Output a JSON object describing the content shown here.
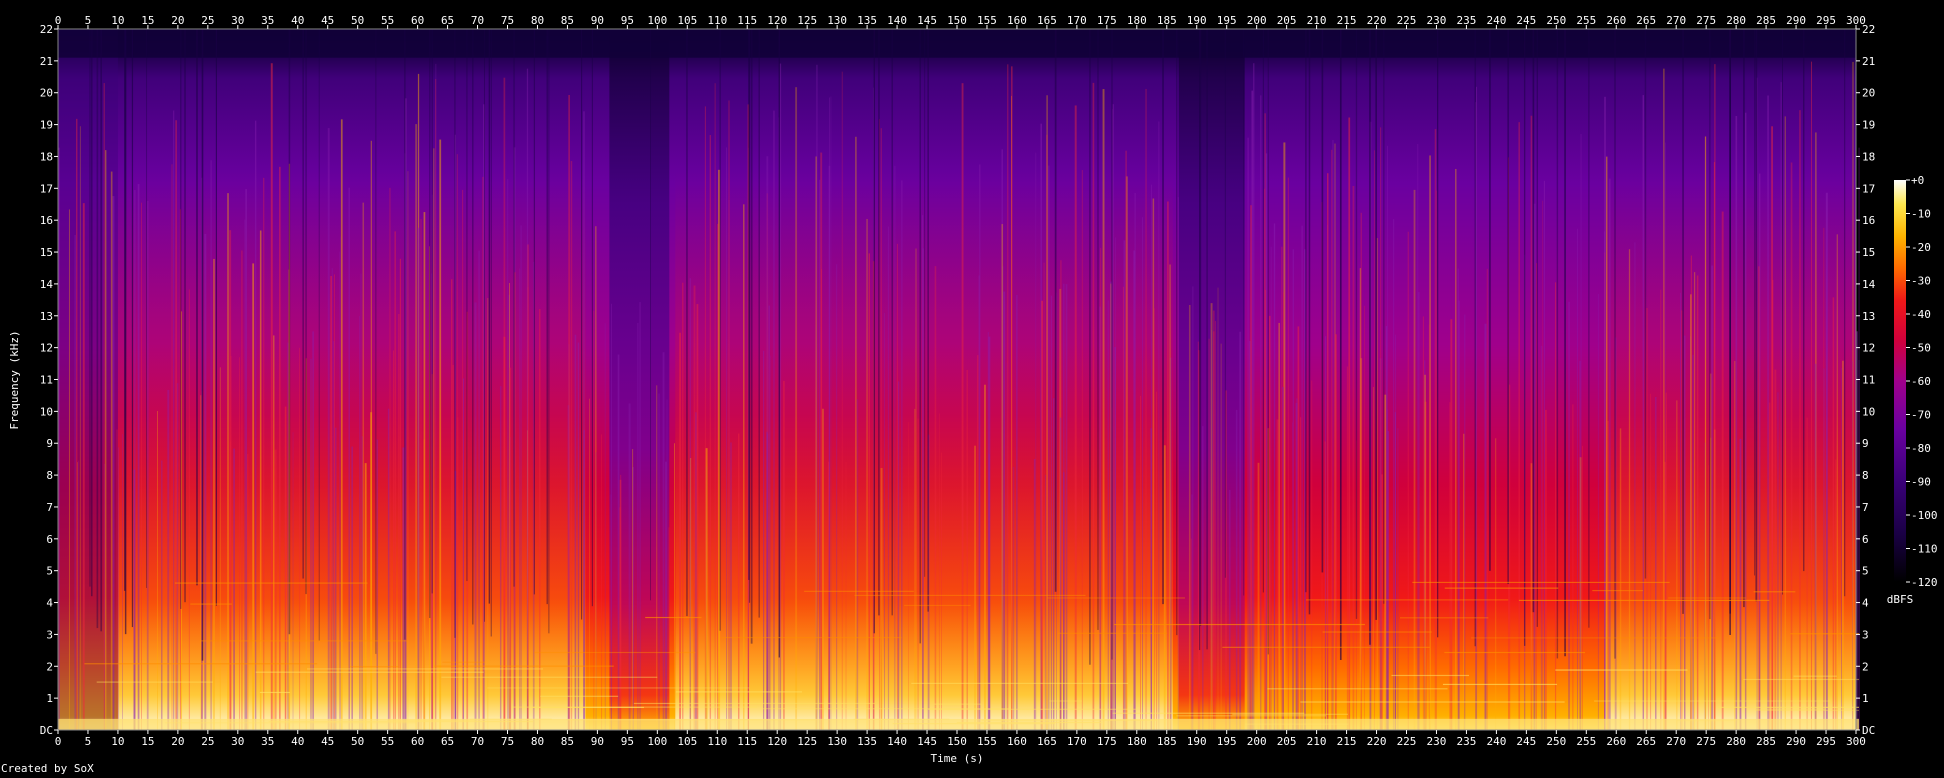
{
  "chart_data": {
    "type": "heatmap",
    "subtype": "spectrogram",
    "xlabel": "Time (s)",
    "ylabel": "Frequency (kHz)",
    "xlim": [
      0,
      300
    ],
    "ylim": [
      0,
      22
    ],
    "x_ticks": [
      "0",
      "5",
      "10",
      "15",
      "20",
      "25",
      "30",
      "35",
      "40",
      "45",
      "50",
      "55",
      "60",
      "65",
      "70",
      "75",
      "80",
      "85",
      "90",
      "95",
      "100",
      "105",
      "110",
      "115",
      "120",
      "125",
      "130",
      "135",
      "140",
      "145",
      "150",
      "155",
      "160",
      "165",
      "170",
      "175",
      "180",
      "185",
      "190",
      "195",
      "200",
      "205",
      "210",
      "215",
      "220",
      "225",
      "230",
      "235",
      "240",
      "245",
      "250",
      "255",
      "260",
      "265",
      "270",
      "275",
      "280",
      "285",
      "290",
      "295",
      "300"
    ],
    "y_ticks": [
      "DC",
      "1",
      "2",
      "3",
      "4",
      "5",
      "6",
      "7",
      "8",
      "9",
      "10",
      "11",
      "12",
      "13",
      "14",
      "15",
      "16",
      "17",
      "18",
      "19",
      "20",
      "21",
      "22"
    ],
    "colorbar": {
      "label": "dBFS",
      "range": [
        -120,
        0
      ],
      "ticks": [
        "+0",
        "-10",
        "-20",
        "-30",
        "-40",
        "-50",
        "-60",
        "-70",
        "-80",
        "-90",
        "-100",
        "-110",
        "-120"
      ]
    },
    "colormap": [
      "#000000",
      "#1a0045",
      "#3a0078",
      "#6a00a0",
      "#a0008c",
      "#d0003c",
      "#f01818",
      "#ff6a00",
      "#ffb400",
      "#ffe850",
      "#ffffff"
    ],
    "audio_end_s": 300.5,
    "quiet_sections_s": [
      [
        92,
        102
      ],
      [
        187,
        198
      ]
    ],
    "loud_sections_s": [
      [
        10,
        88
      ],
      [
        103,
        186
      ],
      [
        258,
        300
      ]
    ],
    "grid": false
  },
  "footer": {
    "credit": "Created by SoX"
  }
}
